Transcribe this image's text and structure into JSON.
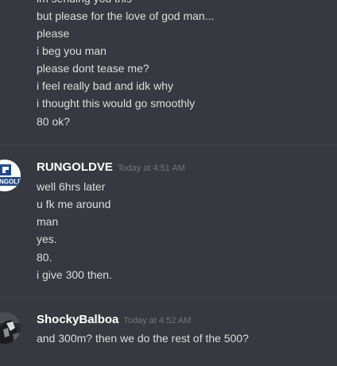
{
  "messages": [
    {
      "author": "",
      "timestamp": "",
      "lines": [
        "im sending you this",
        "but please for the love of god man...",
        "please",
        "i beg you man",
        "please dont tease me?",
        "i feel really bad and idk why",
        "i thought this would go smoothly",
        "80 ok?"
      ]
    },
    {
      "author": "RUNGOLDVE",
      "timestamp": "Today at 4:51 AM",
      "avatar": "rungold-logo-avatar",
      "avatar_text": "NGOLD",
      "lines": [
        "well 6hrs later",
        "u fk me around",
        "man",
        "yes.",
        "80.",
        "i give 300 then."
      ]
    },
    {
      "author": "ShockyBalboa",
      "timestamp": "Today at 4:52 AM",
      "avatar": "user-photo-avatar",
      "lines": [
        "and 300m? then we do the rest of the 500?"
      ]
    }
  ],
  "colors": {
    "background": "#36393f",
    "message_text": "#dcddde",
    "author": "#ffffff",
    "timestamp": "#72767d",
    "divider": "#42454a",
    "rungold_blue": "#1e4a8c"
  }
}
